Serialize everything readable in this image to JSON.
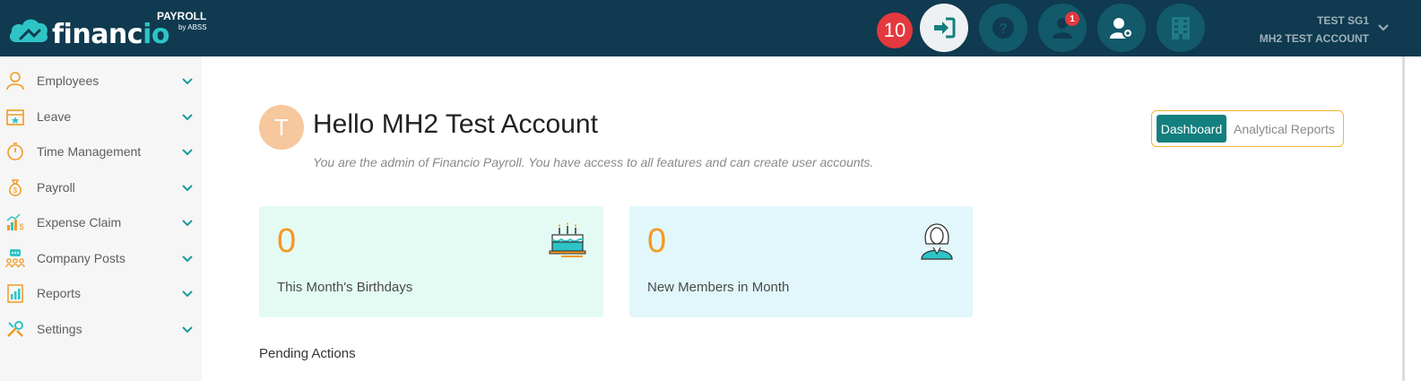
{
  "brand": {
    "name_main": "financ",
    "name_accent": "io",
    "product": "PAYROLL",
    "by": "by ABSS"
  },
  "header": {
    "notifications_count": "10",
    "people_badge": "1",
    "icons": [
      "login-icon",
      "help-icon",
      "user-icon",
      "user-settings-icon",
      "building-icon"
    ],
    "account": {
      "company": "TEST SG1",
      "name": "MH2 TEST ACCOUNT"
    }
  },
  "sidebar": {
    "items": [
      {
        "label": "Employees",
        "icon": "person-icon"
      },
      {
        "label": "Leave",
        "icon": "calendar-icon"
      },
      {
        "label": "Time Management",
        "icon": "stopwatch-icon"
      },
      {
        "label": "Payroll",
        "icon": "money-bag-icon"
      },
      {
        "label": "Expense Claim",
        "icon": "chart-dollar-icon"
      },
      {
        "label": "Company Posts",
        "icon": "chat-group-icon"
      },
      {
        "label": "Reports",
        "icon": "report-icon"
      },
      {
        "label": "Settings",
        "icon": "settings-tools-icon"
      }
    ]
  },
  "main": {
    "avatar_letter": "T",
    "greeting": "Hello MH2 Test Account",
    "subtitle": "You are the admin of Financio Payroll. You have access to all features and can create user accounts.",
    "view_toggle": {
      "active": "Dashboard",
      "other": "Analytical Reports"
    },
    "cards": [
      {
        "value": "0",
        "label": "This Month's Birthdays",
        "icon": "birthday-cake-icon"
      },
      {
        "value": "0",
        "label": "New Members in Month",
        "icon": "new-member-icon"
      }
    ],
    "pending_title": "Pending Actions"
  },
  "colors": {
    "header_bg": "#0f3a4f",
    "header_button": "#12596a",
    "accent_teal": "#137f7e",
    "accent_orange": "#f39a23",
    "badge_red": "#e3393f",
    "sidebar_bg": "#f6f6f6"
  }
}
